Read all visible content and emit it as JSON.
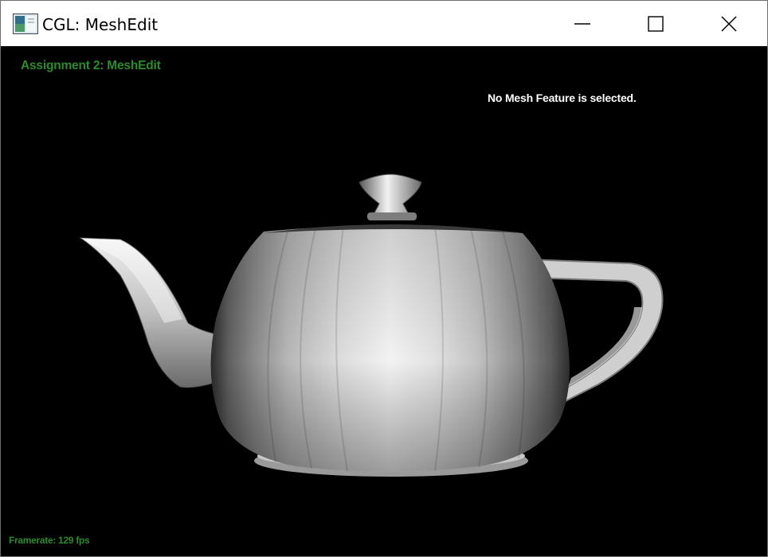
{
  "window": {
    "title": "CGL: MeshEdit",
    "controls": {
      "minimize": "minimize-icon",
      "maximize": "maximize-icon",
      "close": "close-icon"
    }
  },
  "hud": {
    "assignment_title": "Assignment 2: MeshEdit",
    "selection_status": "No Mesh Feature is selected.",
    "framerate": "Framerate: 129 fps"
  },
  "colors": {
    "hud_green": "#2c8c2c",
    "hud_white": "#ffffff",
    "viewport_bg": "#000000"
  },
  "scene": {
    "object": "teapot-mesh"
  }
}
